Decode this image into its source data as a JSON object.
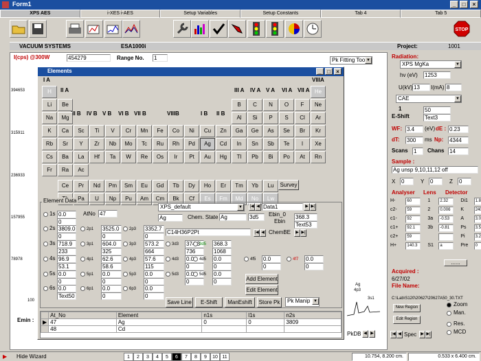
{
  "window": {
    "title": "Form1",
    "minimize": "_",
    "maximize": "□",
    "close": "×"
  },
  "tabs": [
    "XPS AES",
    "i-XES i-AES",
    "Setup Variables",
    "Setup Constants",
    "Tab 4",
    "Tab 5"
  ],
  "stop_label": "STOP",
  "header": {
    "company": "VACUUM SYSTEMS",
    "model": "ESA1000i",
    "project_label": "Project:",
    "project_value": "1001"
  },
  "plot": {
    "y_label": "I(cps) @300W",
    "y_value": "454279",
    "range_label": "Range No.",
    "range_value": "1",
    "pk_fitting": "Pk Fitting Tools",
    "y_ticks": [
      "394653",
      "315911",
      "236933",
      "157955",
      "78978",
      "100"
    ],
    "emin_label": "Emin :",
    "inset_labels": [
      "Ag",
      "4p3",
      "3s1"
    ],
    "nav_label": "PkDB"
  },
  "dialog": {
    "title": "Elements",
    "minimize": "_",
    "maximize": "□",
    "close": "×"
  },
  "periodic": {
    "group_labels": [
      "I A",
      "II A",
      "III A",
      "IV A",
      "V A",
      "VI A",
      "VII A",
      "VIIIA",
      "III B",
      "IV B",
      "V B",
      "VI B",
      "VII B",
      "VIIIB",
      "I B",
      "II B"
    ],
    "rows": [
      [
        "H",
        "He"
      ],
      [
        "Li",
        "Be",
        "B",
        "C",
        "N",
        "O",
        "F",
        "Ne"
      ],
      [
        "Na",
        "Mg",
        "Al",
        "Si",
        "P",
        "S",
        "Cl",
        "Ar"
      ],
      [
        "K",
        "Ca",
        "Sc",
        "Ti",
        "V",
        "Cr",
        "Mn",
        "Fe",
        "Co",
        "Ni",
        "Cu",
        "Zn",
        "Ga",
        "Ge",
        "As",
        "Se",
        "Br",
        "Kr"
      ],
      [
        "Rb",
        "Sr",
        "Y",
        "Zr",
        "Nb",
        "Mo",
        "Tc",
        "Ru",
        "Rh",
        "Pd",
        "Ag",
        "Cd",
        "In",
        "Sn",
        "Sb",
        "Te",
        "I",
        "Xe"
      ],
      [
        "Cs",
        "Ba",
        "La",
        "Hf",
        "Ta",
        "W",
        "Re",
        "Os",
        "Ir",
        "Pt",
        "Au",
        "Hg",
        "Tl",
        "Pb",
        "Bi",
        "Po",
        "At",
        "Rn"
      ],
      [
        "Fr",
        "Ra",
        "Ac"
      ]
    ],
    "lanthanides": [
      "Ce",
      "Pr",
      "Nd",
      "Pm",
      "Sm",
      "Eu",
      "Gd",
      "Tb",
      "Dy",
      "Ho",
      "Er",
      "Tm",
      "Yb",
      "Lu"
    ],
    "actinides": [
      "Th",
      "Pa",
      "U",
      "Np",
      "Pu",
      "Am",
      "Cm",
      "Bk",
      "Cf",
      "Es",
      "Fm",
      "Md",
      "No",
      "Lw"
    ],
    "survey_label": "Survey"
  },
  "element_data": {
    "legend": "Element Data",
    "atno_label": "AtNo",
    "atno": "47",
    "database": "XPS_default",
    "symbol": "Ag",
    "chem_state_label": "Chem. State",
    "chem_state": "Ag",
    "orbital": "3d5",
    "ebin0_label": "Ebin_0",
    "ebin_label": "Ebin",
    "ebin0": "368.3",
    "text53": "Text53",
    "data_name": "Data1",
    "formula": "C14H36P2Pt",
    "chembe": "ChemBE",
    "orbitals": [
      {
        "name": "1s",
        "val": "0.0",
        "sub": "0"
      },
      {
        "name": "2s",
        "val": "3809.0",
        "sub": "0"
      },
      {
        "name": "3s",
        "val": "718.9",
        "sub": "233"
      },
      {
        "name": "4s",
        "val": "96.9",
        "sub": "53.1"
      },
      {
        "name": "5s",
        "val": "0.0",
        "sub": "0"
      },
      {
        "name": "6s",
        "val": "0.0",
        "sub": "Text50"
      }
    ],
    "p_orbitals": [
      {
        "name": "2p1",
        "val": "3525.0",
        "sub": "0"
      },
      {
        "name": "3p1",
        "val": "604.0",
        "sub": "325"
      },
      {
        "name": "4p1",
        "val": "62.6",
        "sub": "58.6"
      },
      {
        "name": "5p1",
        "val": "0.0",
        "sub": "0"
      },
      {
        "name": "6p1",
        "val": "0.0",
        "sub": "0"
      }
    ],
    "p3_orbitals": [
      {
        "name": "2p3",
        "val": "3352.7",
        "sub": "0"
      },
      {
        "name": "3p3",
        "val": "573.2",
        "sub": "664"
      },
      {
        "name": "4p3",
        "val": "57.6",
        "sub": "115"
      },
      {
        "name": "5p3",
        "val": "0.0",
        "sub": "0"
      },
      {
        "name": "6p3",
        "val": "0.0",
        "sub": "0"
      }
    ],
    "d_orbitals": [
      {
        "name": "3d3",
        "val": "374.3",
        "sub": "736"
      },
      {
        "name": "4d3",
        "val": "0.0",
        "sub": "0"
      },
      {
        "name": "5d3",
        "val": "0.0",
        "sub": "0"
      }
    ],
    "d5_orbitals": [
      {
        "name": "3d5",
        "val": "368.3",
        "sub": "1068"
      },
      {
        "name": "4d5",
        "val": "0.0",
        "sub": "0"
      },
      {
        "name": "5d5",
        "val": "0.0",
        "sub": "0"
      }
    ],
    "f_orbitals": [
      {
        "name": "4f5",
        "val": "0.0",
        "sub": "0"
      },
      {
        "name": "4f7",
        "val": "0.0",
        "sub": "0"
      }
    ],
    "add_element": "Add Element",
    "edit_element": "Edit Element",
    "save_line": "Save Line",
    "eshift": "E-Shift",
    "manshift": "ManEshift",
    "store_pk": "Store Pk",
    "pk_manip": "Pk Manip"
  },
  "table": {
    "headers": [
      "At_No",
      "Element",
      "n1s",
      "l1s",
      "n2s"
    ],
    "rows": [
      [
        "47",
        "Ag",
        "0",
        "0",
        "3809"
      ],
      [
        "48",
        "Cd",
        "",
        "",
        ""
      ]
    ]
  },
  "right": {
    "radiation_label": "Radiation:",
    "radiation": "XPS MgKa",
    "hv_label": "hv (eV)",
    "hv": "1253",
    "u_label": "U(kV)",
    "u": "13",
    "i_label": "I(mA)",
    "i": "8",
    "analyser_mode": "CAE",
    "num": "1",
    "val50": "50",
    "eshift_label": "E-Shift",
    "text3": "Text3",
    "wf_label": "WF:",
    "wf": "3.4",
    "de_unit": "(eV)",
    "de_label": "dE :",
    "de": "0.23",
    "dt_label": "dT:",
    "dt": "300",
    "ms": "ms",
    "np_label": "Np:",
    "np": "4344",
    "scans_label": "Scans",
    "scans": "1",
    "chans_label": "Chans",
    "chans": "14",
    "sample_label": "Sample :",
    "sample": "Ag unsp 9,10,11,12 off",
    "x_label": "X",
    "x": "0",
    "y_label": "Y",
    "y": "0",
    "z_label": "Z",
    "z": "0",
    "analyser_label": "Analyser",
    "lens_label": "Lens",
    "detector_label": "Detector",
    "analyser_rows": [
      [
        "H-",
        "60",
        "1",
        "2.32",
        "Di1",
        "1.8230"
      ],
      [
        "c2-",
        "59",
        "2",
        "0.006",
        "K",
        "240"
      ],
      [
        "c1-",
        "92",
        "3a",
        "-0.53",
        "A",
        "3.02"
      ],
      [
        "c1+",
        "92.1",
        "3b",
        "-0.81",
        "Ps",
        "3.5"
      ],
      [
        "c2+",
        "59",
        "",
        "",
        "Pi",
        "3.23"
      ],
      [
        "H+",
        "140.3",
        "S1",
        "a",
        "Pre",
        "0"
      ]
    ],
    "dots": "......",
    "acquired_label": "Acquired :",
    "acquired": "6/27/02",
    "filename_label": "File Name:",
    "filename": "C:\\Lab\\S120\\20627\\20627A50_30.TXT",
    "new_region": "New Region",
    "edit_region": "Edit Region",
    "zoom": "Zoom",
    "man": "Man.",
    "res": "Res.",
    "mcd": "MCD",
    "spec": "Spec"
  },
  "statusbar": {
    "hide_wizard": "Hide Wizard",
    "pages": [
      "1",
      "2",
      "3",
      "4",
      "5",
      "6",
      "7",
      "8",
      "9",
      "10",
      "11"
    ],
    "active_page": "6",
    "coords": "10.754, 8.200 cm.",
    "size": "0.533 x 6.400 cm."
  },
  "colors": {
    "titlebar": "#1b4fa0",
    "red": "#c00000",
    "face": "#d4d0c8"
  }
}
